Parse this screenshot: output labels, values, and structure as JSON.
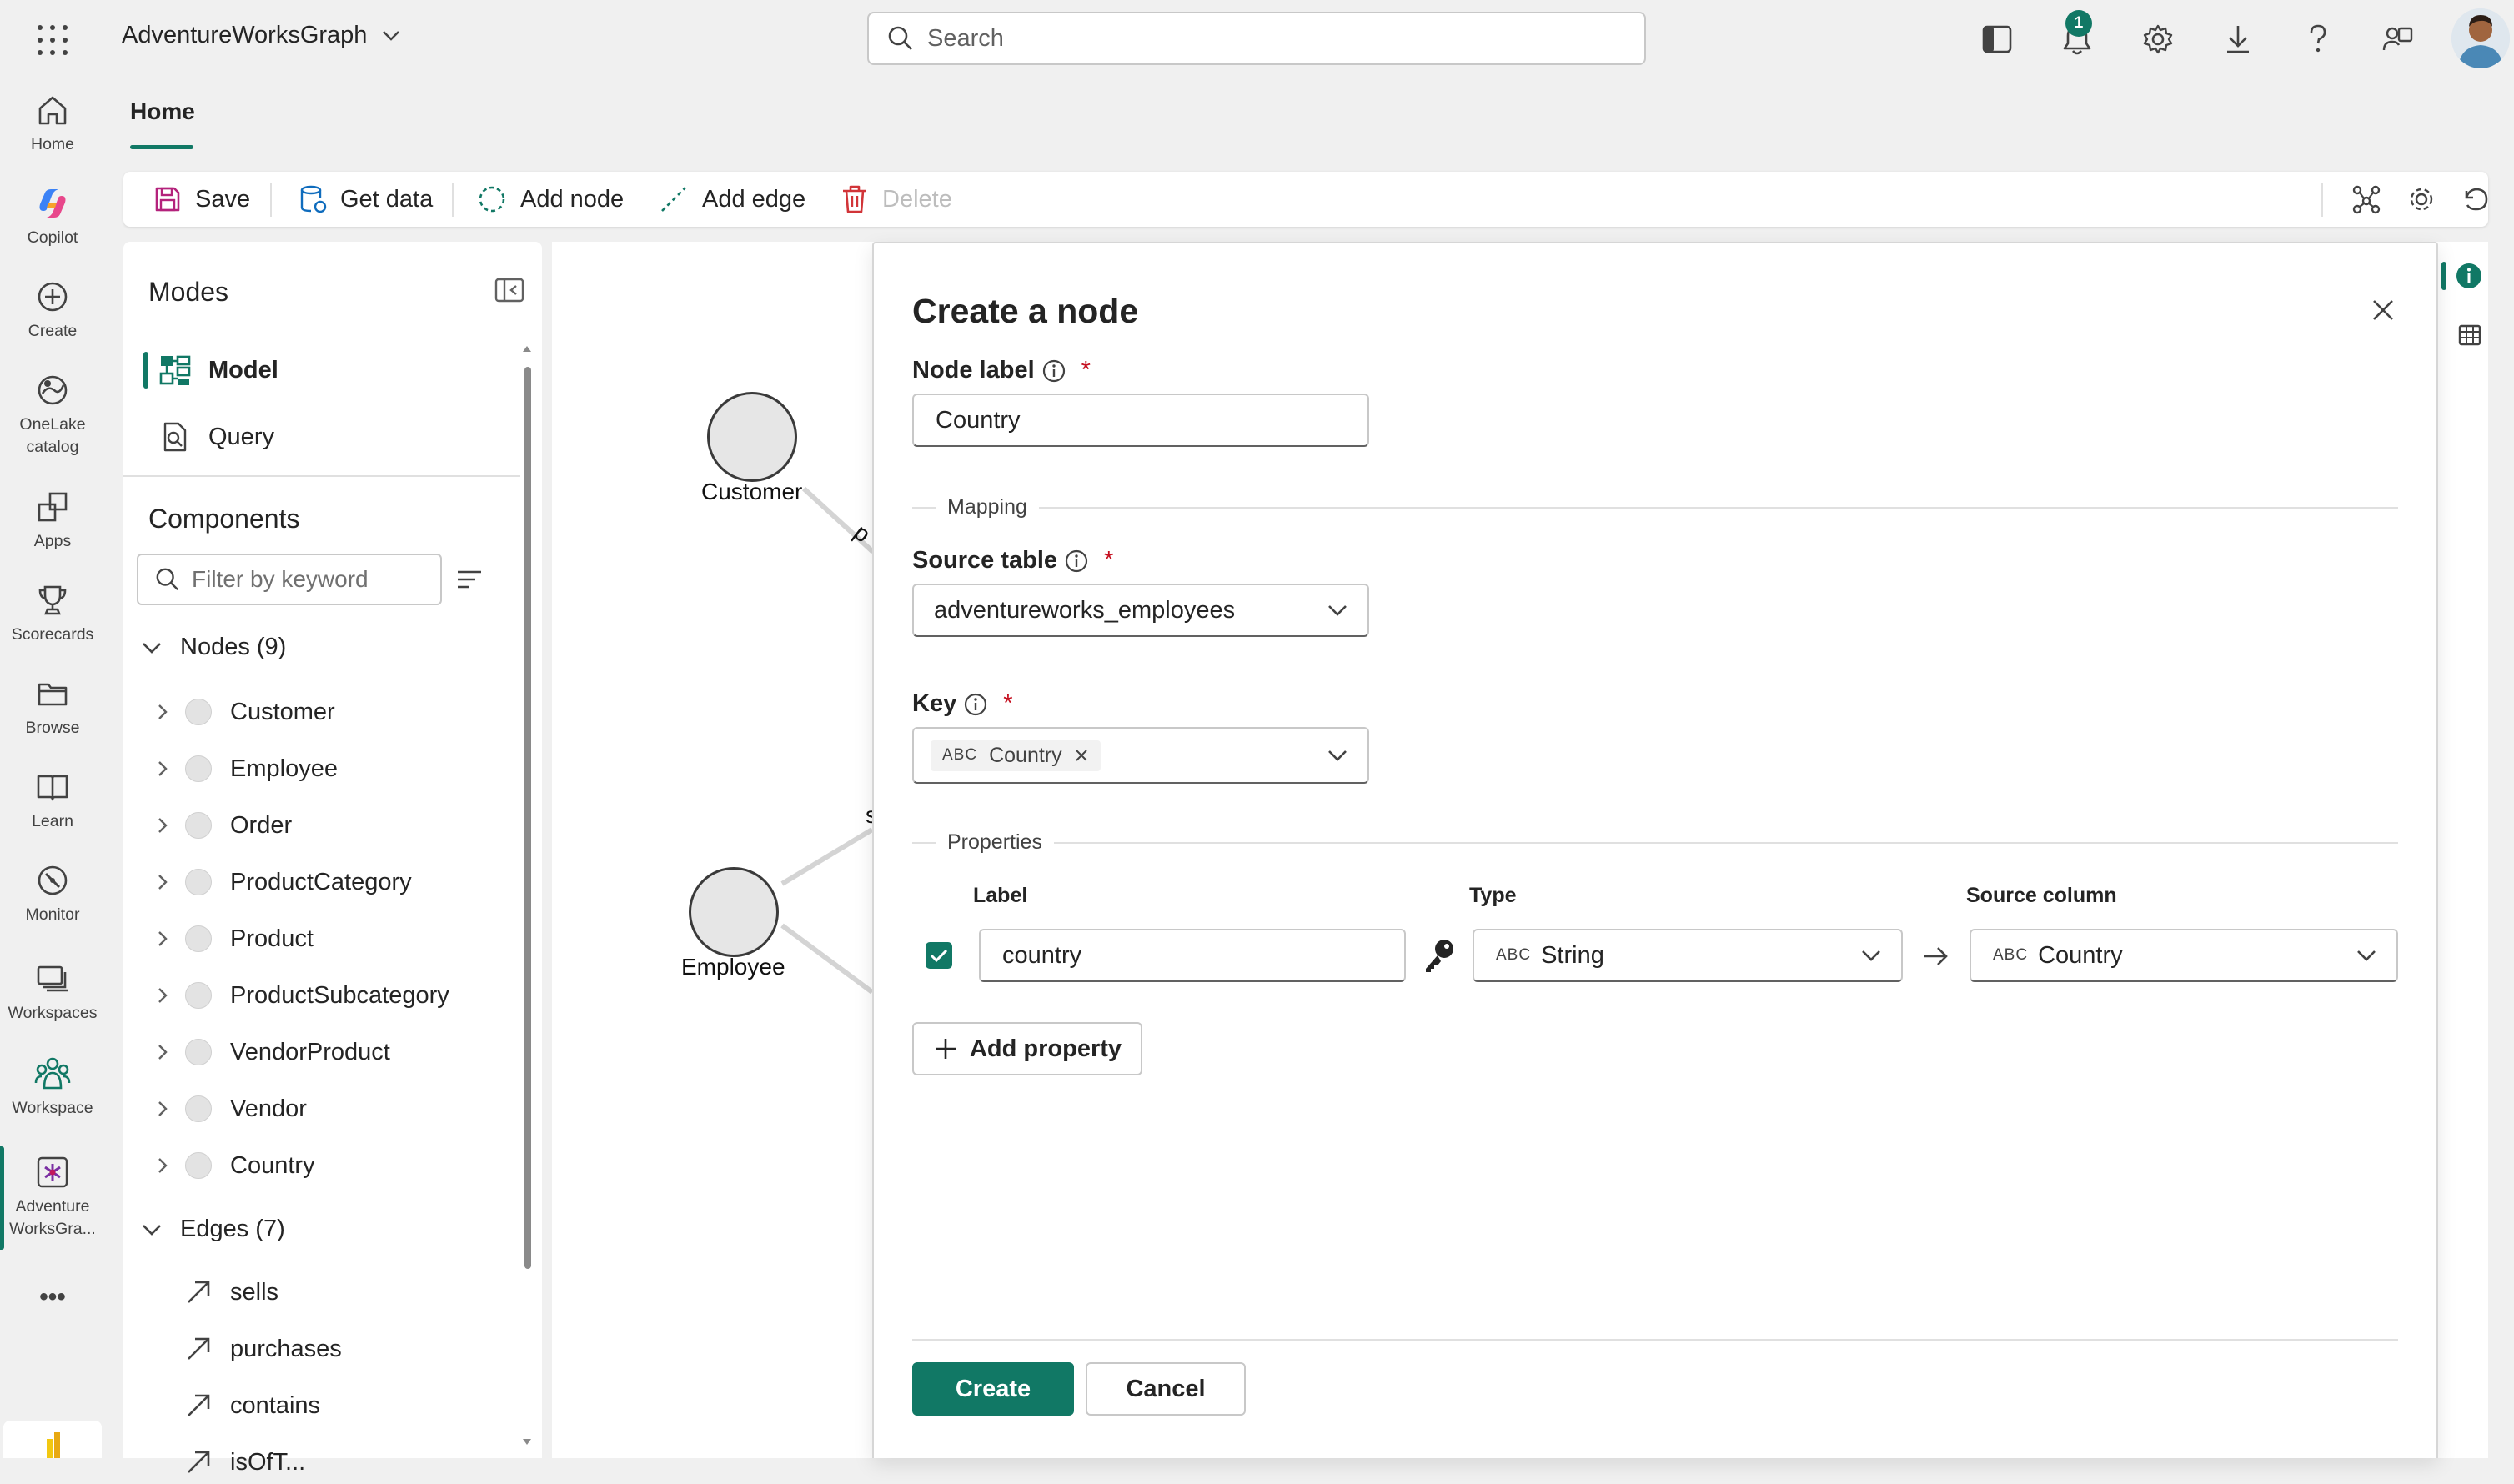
{
  "app": {
    "workspace_title": "AdventureWorksGraph",
    "search_placeholder": "Search",
    "notification_count": "1"
  },
  "rail": {
    "items": [
      {
        "label": "Home",
        "icon": "home-icon"
      },
      {
        "label": "Copilot",
        "icon": "copilot-icon"
      },
      {
        "label": "Create",
        "icon": "create-icon"
      },
      {
        "label": "OneLake catalog",
        "icon": "onelake-icon"
      },
      {
        "label": "Apps",
        "icon": "apps-icon"
      },
      {
        "label": "Scorecards",
        "icon": "scorecards-icon"
      },
      {
        "label": "Browse",
        "icon": "browse-icon"
      },
      {
        "label": "Learn",
        "icon": "learn-icon"
      },
      {
        "label": "Monitor",
        "icon": "monitor-icon"
      },
      {
        "label": "Workspaces",
        "icon": "workspaces-icon"
      },
      {
        "label": "Workspace",
        "icon": "workspace-icon"
      },
      {
        "label": "Adventure WorksGra...",
        "icon": "graph-icon"
      }
    ],
    "more": "•••"
  },
  "tabs": {
    "home": "Home"
  },
  "toolbar": {
    "save": "Save",
    "get_data": "Get data",
    "add_node": "Add node",
    "add_edge": "Add edge",
    "delete": "Delete"
  },
  "modes_panel": {
    "title": "Modes",
    "model": "Model",
    "query": "Query",
    "components_title": "Components",
    "filter_placeholder": "Filter by keyword",
    "nodes_header": "Nodes (9)",
    "nodes": [
      "Customer",
      "Employee",
      "Order",
      "ProductCategory",
      "Product",
      "ProductSubcategory",
      "VendorProduct",
      "Vendor",
      "Country"
    ],
    "edges_header": "Edges (7)",
    "edges": [
      "sells",
      "purchases",
      "contains",
      "isOfT..."
    ]
  },
  "canvas": {
    "nodes": [
      {
        "label": "Customer"
      },
      {
        "label": "Employee"
      }
    ],
    "edge_fragment_1": "p",
    "edge_fragment_2": "s"
  },
  "dialog": {
    "title": "Create a node",
    "node_label": "Node label",
    "node_label_value": "Country",
    "mapping_section": "Mapping",
    "source_table_label": "Source table",
    "source_table_value": "adventureworks_employees",
    "key_label": "Key",
    "key_chip_type": "ABC",
    "key_chip_value": "Country",
    "properties_section": "Properties",
    "col_label": "Label",
    "col_type": "Type",
    "col_source": "Source column",
    "property_label_value": "country",
    "property_type_prefix": "ABC",
    "property_type_value": "String",
    "property_source_prefix": "ABC",
    "property_source_value": "Country",
    "add_property": "Add property",
    "create": "Create",
    "cancel": "Cancel"
  },
  "colors": {
    "accent": "#117865",
    "required": "#c50f1f",
    "save_icon": "#b4227c",
    "delete_icon": "#d13438"
  }
}
